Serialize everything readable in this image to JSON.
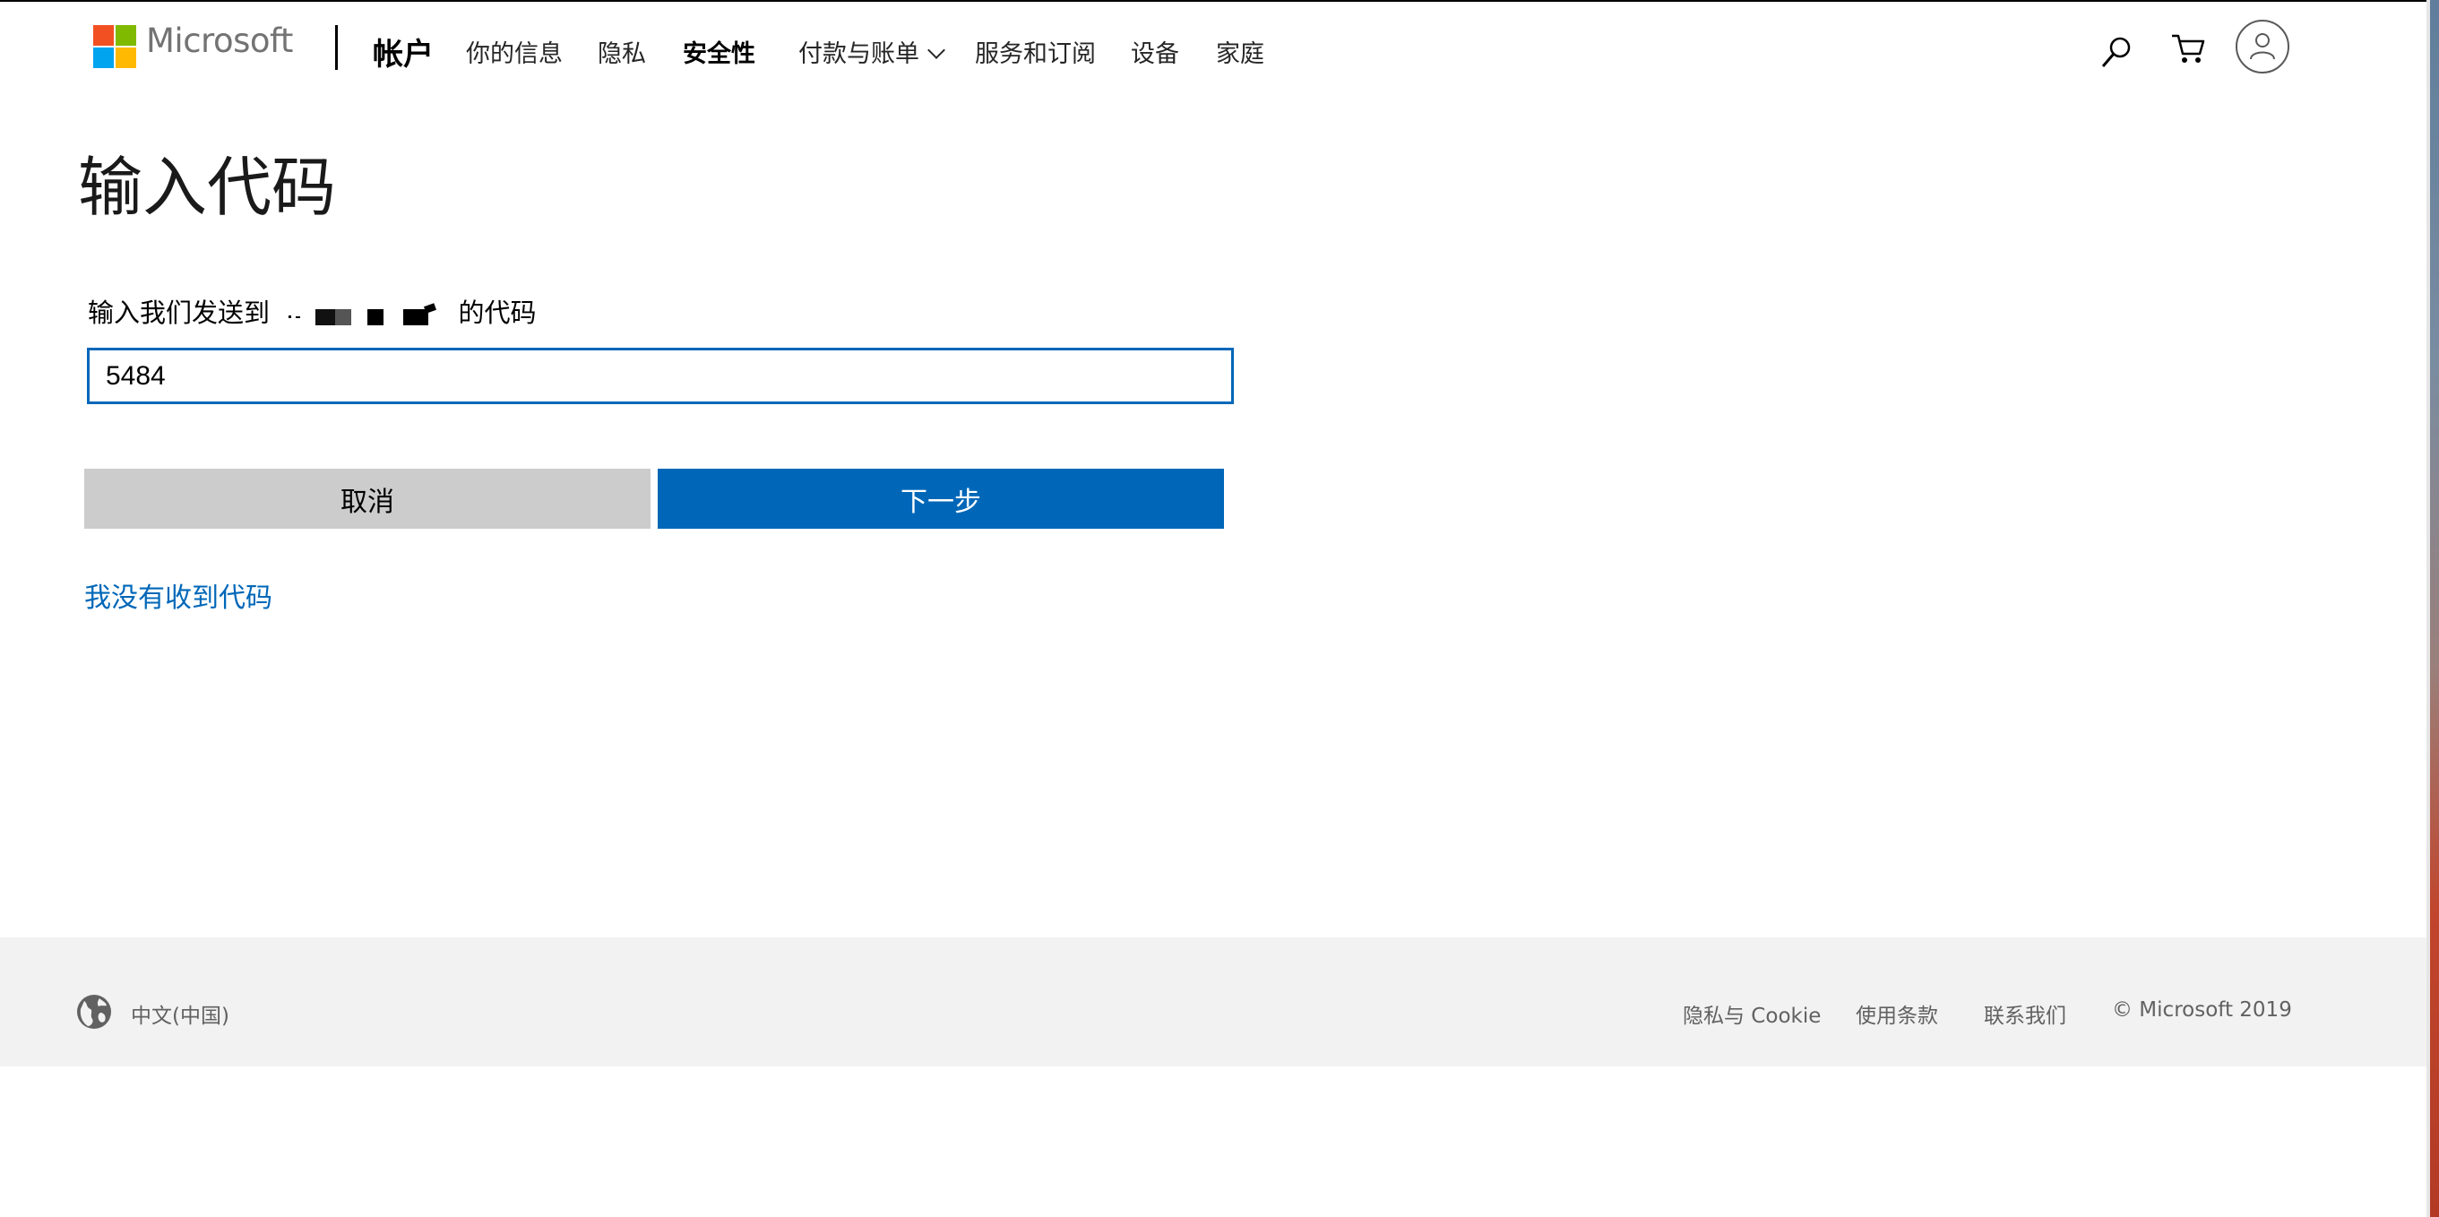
{
  "header": {
    "brand": "Microsoft",
    "section_title": "帐户",
    "nav": {
      "your_info": "你的信息",
      "privacy": "隐私",
      "security": "安全性",
      "payment_billing": "付款与账单",
      "services_subscriptions": "服务和订阅",
      "devices": "设备",
      "family": "家庭"
    },
    "icons": [
      "search-icon",
      "cart-icon",
      "user-icon"
    ]
  },
  "main": {
    "title": "输入代码",
    "instruction_prefix": "输入我们发送到",
    "instruction_suffix": "的代码",
    "code_value": "5484",
    "cancel_label": "取消",
    "next_label": "下一步",
    "resend_link": "我没有收到代码"
  },
  "footer": {
    "locale": "中文(中国)",
    "privacy_cookie": "隐私与 Cookie",
    "terms": "使用条款",
    "contact": "联系我们",
    "copyright": "© Microsoft 2019"
  },
  "colors": {
    "accent": "#0067b8",
    "logo_red": "#f25022",
    "logo_green": "#7fba00",
    "logo_blue": "#00a4ef",
    "logo_yellow": "#ffb900",
    "footer_bg": "#f2f2f2"
  }
}
